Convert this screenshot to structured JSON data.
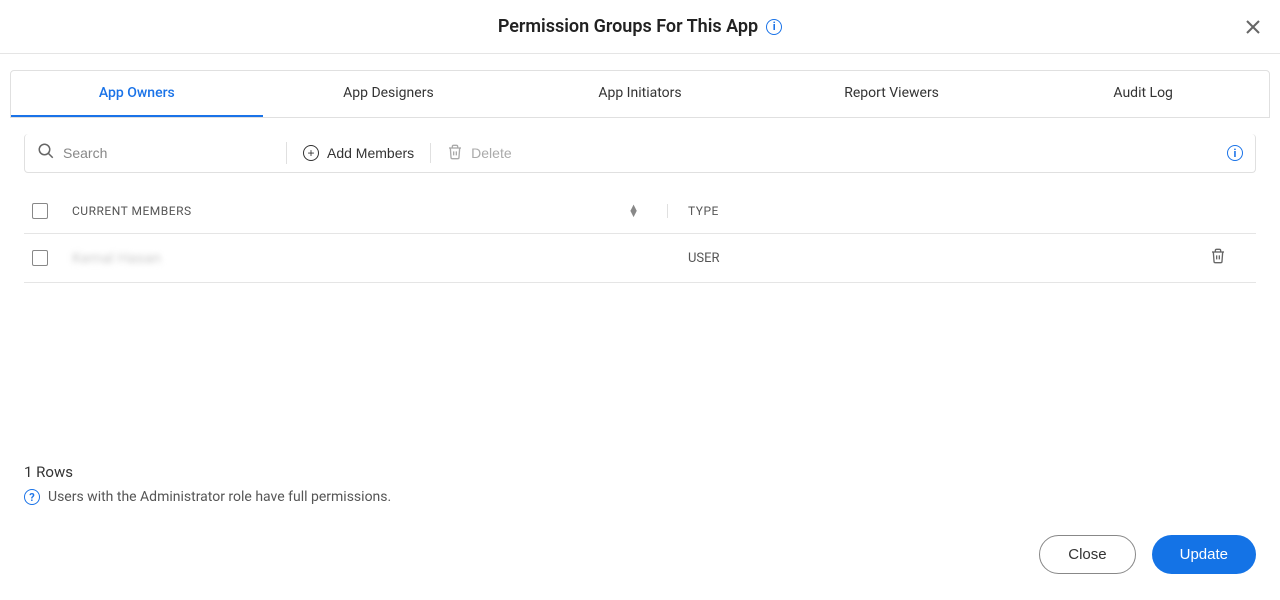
{
  "header": {
    "title": "Permission Groups For This App"
  },
  "tabs": [
    {
      "label": "App Owners",
      "active": true
    },
    {
      "label": "App Designers",
      "active": false
    },
    {
      "label": "App Initiators",
      "active": false
    },
    {
      "label": "Report Viewers",
      "active": false
    },
    {
      "label": "Audit Log",
      "active": false
    }
  ],
  "toolbar": {
    "search_placeholder": "Search",
    "add_members_label": "Add Members",
    "delete_label": "Delete"
  },
  "table": {
    "headers": {
      "members": "CURRENT MEMBERS",
      "type": "TYPE"
    },
    "rows": [
      {
        "name": "Kemal Hasan",
        "type": "USER"
      }
    ]
  },
  "footer": {
    "rows_label": "1 Rows",
    "admin_note": "Users with the Administrator role have full permissions.",
    "close_label": "Close",
    "update_label": "Update"
  }
}
